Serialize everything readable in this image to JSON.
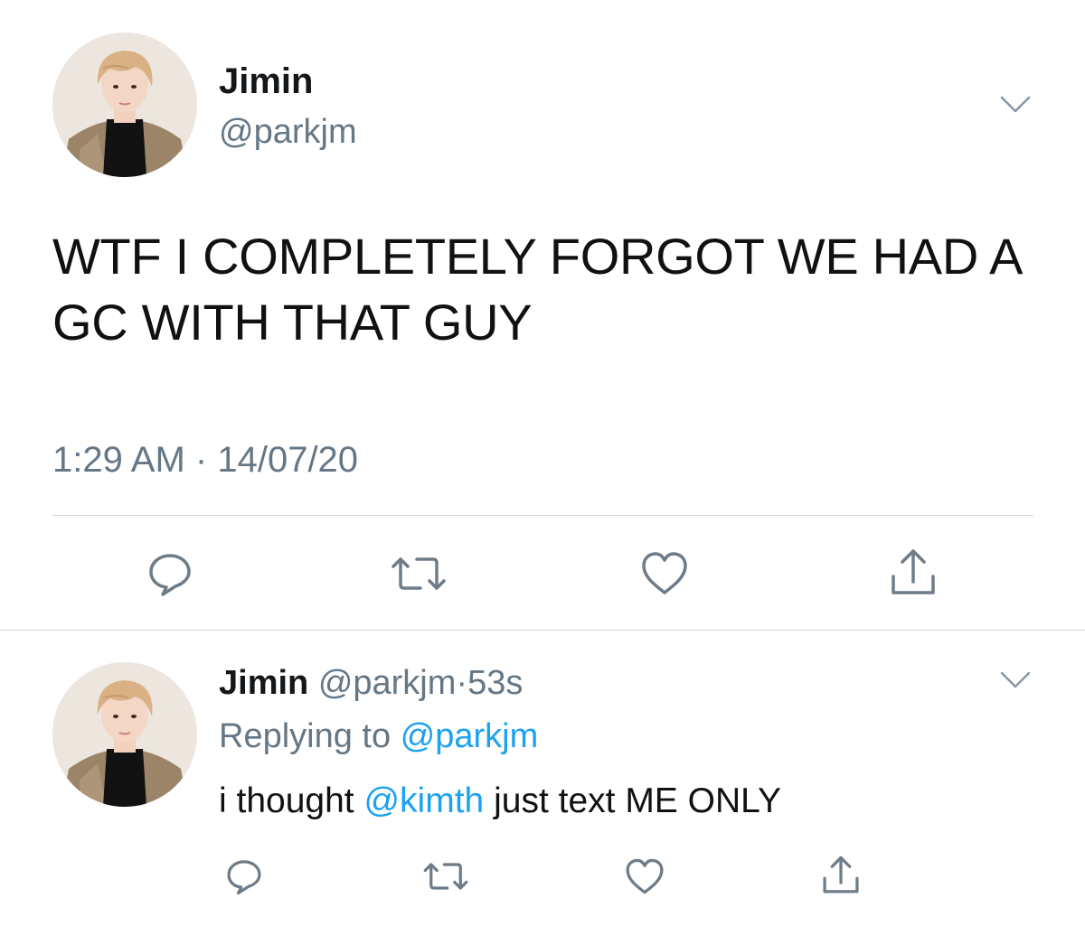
{
  "tweet": {
    "display_name": "Jimin",
    "handle": "@parkjm",
    "text": "WTF I COMPLETELY FORGOT WE HAD A GC WITH THAT GUY",
    "time": "1:29 AM",
    "separator": "·",
    "date": "14/07/20",
    "menu_icon": "chevron-down-icon",
    "actions": [
      "reply-icon",
      "retweet-icon",
      "like-icon",
      "share-icon"
    ]
  },
  "reply": {
    "display_name": "Jimin",
    "handle": "@parkjm",
    "separator": "·",
    "age": "53s",
    "replying_prefix": "Replying to",
    "replying_to": "@parkjm",
    "text_before": "i thought",
    "mention": "@kimth",
    "text_after": "just text ME ONLY",
    "menu_icon": "chevron-down-icon",
    "actions": [
      "reply-icon",
      "retweet-icon",
      "like-icon",
      "share-icon"
    ]
  },
  "colors": {
    "text_secondary": "#657786",
    "link": "#1da1f2",
    "divider": "#d5d5d5",
    "icon": "#6e7b88"
  }
}
